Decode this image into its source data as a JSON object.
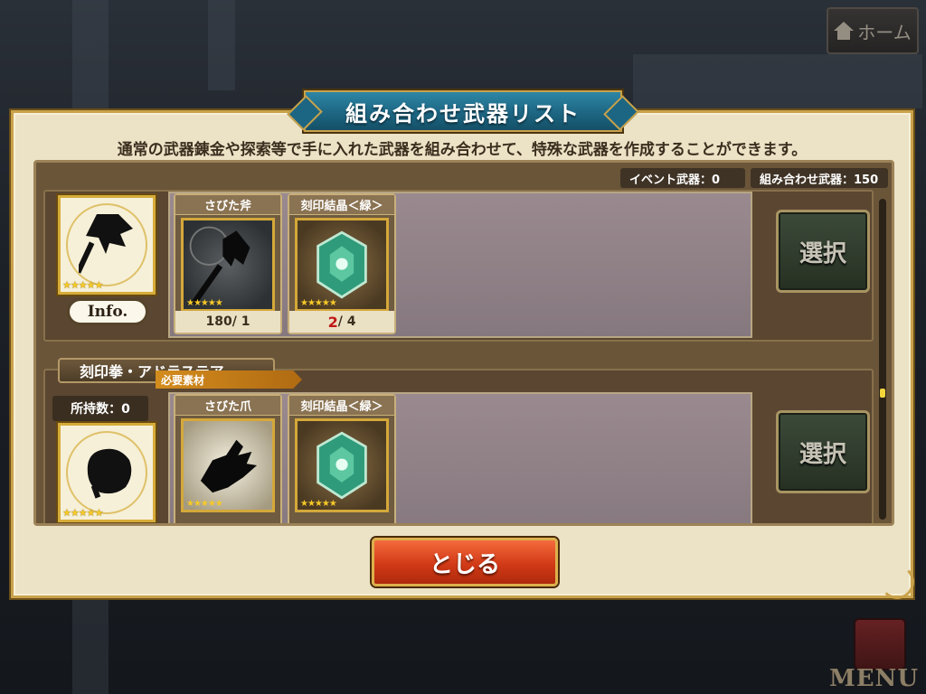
{
  "header": {
    "home_label": "ホーム"
  },
  "dialog": {
    "title": "組み合わせ武器リスト",
    "description": "通常の武器錬金や探索等で手に入れた武器を組み合わせて、特殊な武器を作成することができます。",
    "event_weapons": "イベント武器：0",
    "combined_weapons": "組み合わせ武器：150",
    "close_label": "とじる"
  },
  "rows": [
    {
      "weapon_stars": "★★★★★",
      "info_label": "Info.",
      "materials": [
        {
          "name": "さびた斧",
          "count_have": "180",
          "count_need": "/ 1",
          "stars": "★★★★★",
          "type": "axe"
        },
        {
          "name": "刻印結晶＜緑＞",
          "count_have": "2",
          "count_need": " / 4",
          "stars": "★★★★★",
          "type": "gem"
        }
      ],
      "select_label": "選択"
    },
    {
      "name": "刻印拳・アドラステア",
      "owned": "所持数：0",
      "required_label": "必要素材",
      "weapon_stars": "★★★★★",
      "materials": [
        {
          "name": "さびた爪",
          "stars": "★★★★★",
          "type": "claw"
        },
        {
          "name": "刻印結晶＜緑＞",
          "stars": "★★★★★",
          "type": "gem"
        }
      ],
      "select_label": "選択"
    }
  ],
  "footer": {
    "menu_label": "MENU"
  },
  "colors": {
    "title_plate": "#1d6683",
    "close_button": "#d23a17",
    "gold_border": "#c9a24a",
    "shortage_red": "#c01818"
  }
}
